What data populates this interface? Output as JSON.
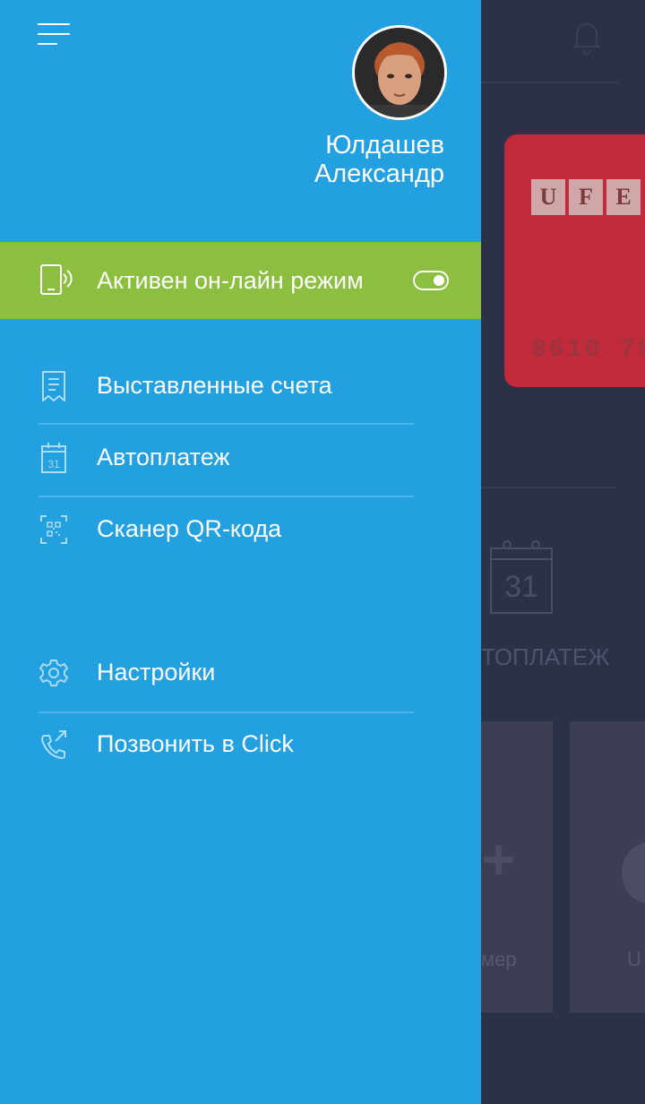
{
  "drawer": {
    "menu_icon": "hamburger-icon",
    "user": {
      "first_line": "Юлдашев",
      "second_line": "Александр",
      "avatar": "user-avatar-photo"
    },
    "online_mode": {
      "label": "Активен он-лайн режим",
      "icon": "phone-signal-icon",
      "enabled": true
    },
    "items": [
      {
        "label": "Выставленные счета",
        "icon": "receipt-icon"
      },
      {
        "label": "Автоплатеж",
        "icon": "calendar-icon"
      },
      {
        "label": "Сканер QR-кода",
        "icon": "qr-scan-icon"
      },
      {
        "label": "Настройки",
        "icon": "gear-icon"
      },
      {
        "label": "Позвонить в Click",
        "icon": "phone-call-icon"
      }
    ],
    "colors": {
      "drawer_bg": "#23a0e0",
      "online_bar_bg": "#8cbf3f",
      "overlay_bg": "#2b3147"
    }
  },
  "background": {
    "card_number": "8610 79",
    "card_logo_letters": [
      "U",
      "F",
      "E"
    ],
    "calendar_day": "31",
    "autopay_label_partial": "ТОПЛАТЕЖ",
    "tile1_label_partial": "мер",
    "tile2_label_partial": "U"
  }
}
